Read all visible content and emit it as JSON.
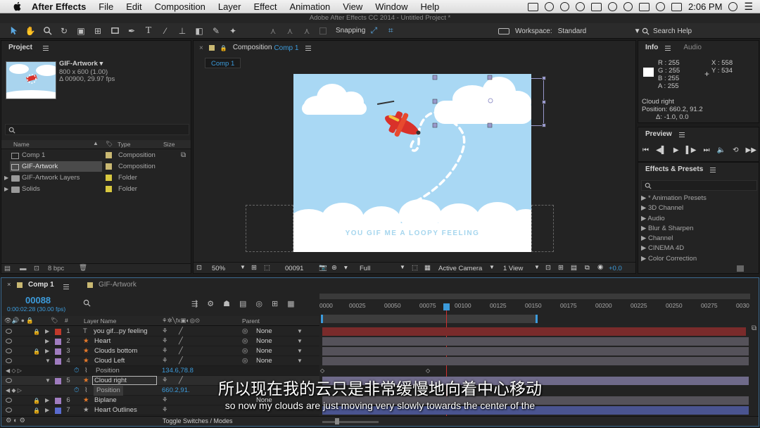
{
  "menubar": {
    "app": "After Effects",
    "items": [
      "File",
      "Edit",
      "Composition",
      "Layer",
      "Effect",
      "Animation",
      "View",
      "Window",
      "Help"
    ],
    "clock": "2:06 PM"
  },
  "window": {
    "title": "Adobe After Effects CC 2014 - Untitled Project *"
  },
  "toolbar": {
    "snapping": "Snapping",
    "workspace_label": "Workspace:",
    "workspace_value": "Standard",
    "search_placeholder": "Search Help"
  },
  "project": {
    "tab": "Project",
    "selected_name": "GIF-Artwork ▾",
    "dims": "800 x 600 (1.00)",
    "duration": "Δ 00900, 29.97 fps",
    "columns": {
      "name": "Name",
      "type": "Type",
      "size": "Size"
    },
    "items": [
      {
        "name": "Comp 1",
        "type": "Composition",
        "color": "#c9b872"
      },
      {
        "name": "GIF-Artwork",
        "type": "Composition",
        "color": "#c9b872"
      },
      {
        "name": "GIF-Artwork Layers",
        "type": "Folder",
        "color": "#d8c840"
      },
      {
        "name": "Solids",
        "type": "Folder",
        "color": "#d8c840"
      }
    ],
    "bpc": "8 bpc"
  },
  "composition": {
    "panel_title": "Composition",
    "comp_name": "Comp 1",
    "tab": "Comp 1",
    "canvas_text": "YOU GIF ME A LOOPY FEELING",
    "zoom": "50%",
    "timecode": "00091",
    "resolution": "Full",
    "camera": "Active Camera",
    "view": "1 View",
    "exposure": "+0.0"
  },
  "info": {
    "tab": "Info",
    "tab2": "Audio",
    "r": "R : 255",
    "g": "G : 255",
    "b": "B : 255",
    "a": "A : 255",
    "x": "X : 558",
    "y": "Y : 534",
    "layer": "Cloud right",
    "position": "Position: 660.2, 91.2",
    "delta": "Δ: -1.0, 0.0"
  },
  "preview": {
    "tab": "Preview"
  },
  "effects": {
    "tab": "Effects & Presets",
    "items": [
      "* Animation Presets",
      "3D Channel",
      "Audio",
      "Blur & Sharpen",
      "Channel",
      "CINEMA 4D",
      "Color Correction"
    ]
  },
  "timeline": {
    "tabs": [
      "Comp 1",
      "GIF-Artwork"
    ],
    "timecode": "00088",
    "subtime": "0:00:02:28 (30.00 fps)",
    "col_layer": "Layer Name",
    "col_parent": "Parent",
    "ruler": [
      "0000",
      "00025",
      "00050",
      "00075",
      "00100",
      "00125",
      "00150",
      "00175",
      "00200",
      "00225",
      "00250",
      "00275",
      "0030"
    ],
    "layers": [
      {
        "num": "1",
        "name": "you gif...py feeling",
        "parent": "None",
        "color": "#c0392b"
      },
      {
        "num": "2",
        "name": "Heart",
        "parent": "None",
        "color": "#a07cc0"
      },
      {
        "num": "3",
        "name": "Clouds bottom",
        "parent": "None",
        "color": "#a07cc0"
      },
      {
        "num": "4",
        "name": "Cloud Left",
        "parent": "None",
        "color": "#a07cc0"
      },
      {
        "num": "5",
        "name": "Cloud right",
        "parent": "None",
        "color": "#a07cc0"
      },
      {
        "num": "6",
        "name": "Biplane",
        "parent": "None",
        "color": "#a07cc0"
      },
      {
        "num": "7",
        "name": "Heart Outlines",
        "parent": "None",
        "color": "#5a6bd0"
      }
    ],
    "prop_label": "Position",
    "prop4_value": "134.6,78.8",
    "prop5_value": "660.2,91.",
    "toggle": "Toggle Switches / Modes"
  },
  "subtitles": {
    "cn": "所以现在我的云只是非常缓慢地向着中心移动",
    "en": "so now my clouds are just moving very slowly towards the center of the"
  }
}
